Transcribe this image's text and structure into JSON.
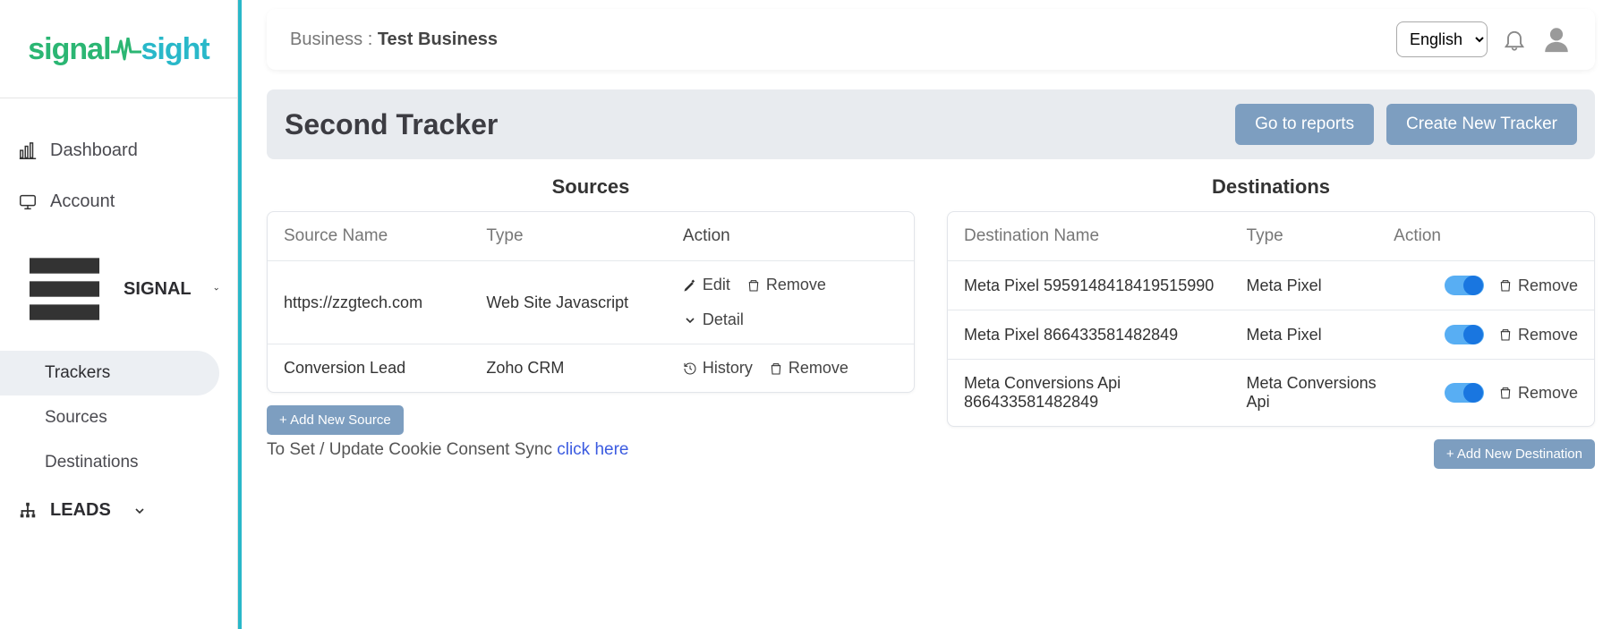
{
  "logo": {
    "part1": "signal",
    "part2": "sight"
  },
  "sidebar": {
    "dashboard": "Dashboard",
    "account": "Account",
    "signal_group": "SIGNAL",
    "sub": {
      "trackers": "Trackers",
      "sources": "Sources",
      "destinations": "Destinations"
    },
    "leads_group": "LEADS"
  },
  "topbar": {
    "label": "Business : ",
    "business": "Test Business",
    "language": "English"
  },
  "title": {
    "text": "Second Tracker",
    "reports_btn": "Go to reports",
    "create_btn": "Create New Tracker"
  },
  "sources": {
    "heading": "Sources",
    "cols": {
      "name": "Source Name",
      "type": "Type",
      "action": "Action"
    },
    "rows": [
      {
        "name": "https://zzgtech.com",
        "type": "Web Site Javascript",
        "actions": {
          "edit": "Edit",
          "remove": "Remove",
          "detail": "Detail"
        }
      },
      {
        "name": "Conversion Lead",
        "type": "Zoho CRM",
        "actions": {
          "history": "History",
          "remove": "Remove"
        }
      }
    ],
    "add_btn": "+ Add New Source",
    "cookie_text": "To Set / Update Cookie Consent Sync ",
    "cookie_link": "click here"
  },
  "destinations": {
    "heading": "Destinations",
    "cols": {
      "name": "Destination Name",
      "type": "Type",
      "action": "Action"
    },
    "rows": [
      {
        "name": "Meta Pixel 5959148418419515990",
        "type": "Meta Pixel",
        "remove": "Remove"
      },
      {
        "name": "Meta Pixel 866433581482849",
        "type": "Meta Pixel",
        "remove": "Remove"
      },
      {
        "name": "Meta Conversions Api 866433581482849",
        "type": "Meta Conversions Api",
        "remove": "Remove"
      }
    ],
    "add_btn": "+ Add New Destination"
  }
}
